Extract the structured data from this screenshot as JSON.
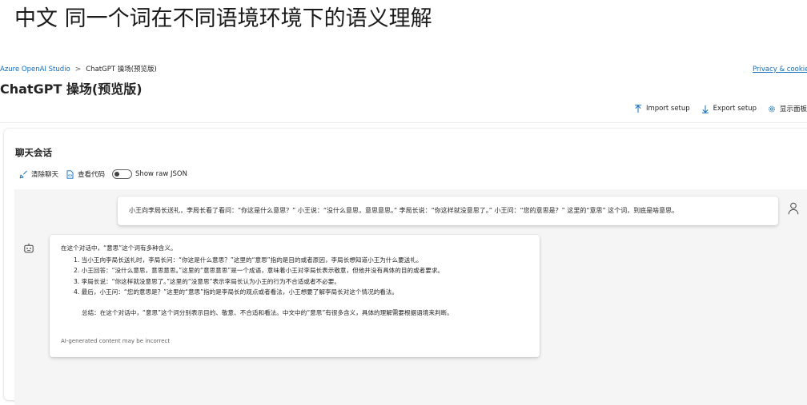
{
  "page": {
    "heading": "中文 同一个词在不同语境环境下的语义理解"
  },
  "breadcrumb": {
    "root": "Azure OpenAI Studio",
    "separator": ">",
    "current": "ChatGPT 操场(预览版)"
  },
  "header": {
    "privacy_link": "Privacy & cookies",
    "title": "ChatGPT 操场(预览版)"
  },
  "toolbar": {
    "import_label": "Import setup",
    "export_label": "Export setup",
    "panels_label": "显示面板",
    "icons": [
      "upload-icon",
      "download-icon",
      "gear-icon"
    ]
  },
  "chat_panel": {
    "title": "聊天会话",
    "clear_label": "清除聊天",
    "view_code_label": "查看代码",
    "raw_json_label": "Show raw JSON",
    "raw_json_enabled": false
  },
  "conversation": {
    "user_message": "小王向李局长送礼，李局长看了看问：“你这是什么意思？” 小王说：“没什么意思，意思意思。” 李局长说：“你这样就没意思了。” 小王问：“您的意思是？” 这里的“意思” 这个词，到底是啥意思。",
    "assistant": {
      "intro": "在这个对话中，“意思”这个词有多种含义。",
      "points": [
        "1. 当小王向李局长送礼时，李局长问：“你这是什么意思？”这里的“意思”指的是目的或者原因，李局长想知道小王为什么要送礼。",
        "2. 小王回答：“没什么意思，意思意思。”这里的“意思意思”是一个成语，意味着小王对李局长表示敬意，但他并没有具体的目的或者要求。",
        "3. 李局长说：“你这样就没意思了。”这里的“没意思”表示李局长认为小王的行为不合适或者不必要。",
        "4. 最后，小王问：“您的意思是？”这里的“意思”指的是李局长的观点或者看法，小王想要了解李局长对这个情况的看法。"
      ],
      "summary": "总结：在这个对话中，“意思”这个词分别表示目的、敬意、不合适和看法。中文中的“意思”有很多含义，具体的理解需要根据语境来判断。",
      "disclaimer": "AI-generated content may be incorrect"
    }
  },
  "colors": {
    "link": "#0f6cbd",
    "text": "#242424",
    "chat_background": "#f5f5f5"
  }
}
